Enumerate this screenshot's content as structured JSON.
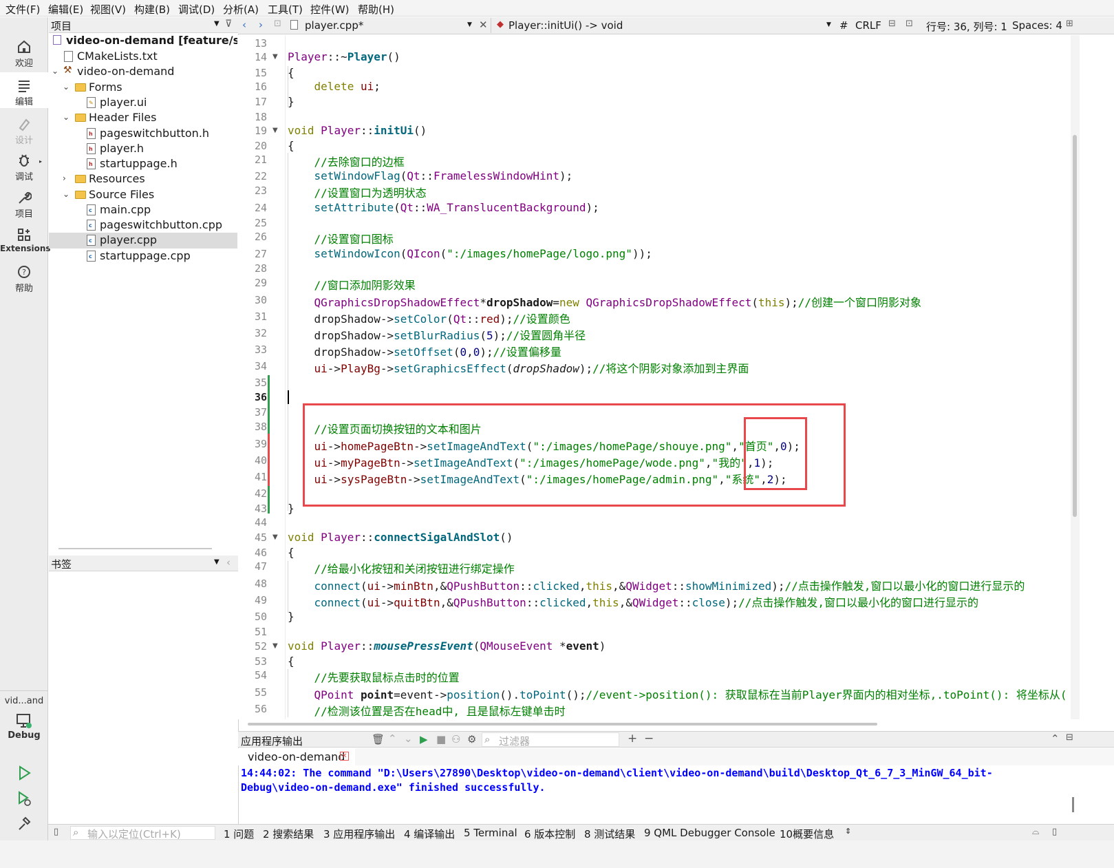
{
  "menu": [
    "文件(F)",
    "编辑(E)",
    "视图(V)",
    "构建(B)",
    "调试(D)",
    "分析(A)",
    "工具(T)",
    "控件(W)",
    "帮助(H)"
  ],
  "modes": {
    "welcome": "欢迎",
    "edit": "编辑",
    "design": "设计",
    "debug": "调试",
    "project": "项目",
    "extensions": "Extensions",
    "help": "帮助",
    "kit_name": "vid...and",
    "kit_mode": "Debug"
  },
  "project_panel": {
    "title": "项目",
    "tree": [
      {
        "label": "video-on-demand [feature/startui"
      },
      {
        "label": "CMakeLists.txt"
      },
      {
        "label": "video-on-demand"
      },
      {
        "label": "Forms"
      },
      {
        "label": "player.ui"
      },
      {
        "label": "Header Files"
      },
      {
        "label": "pageswitchbutton.h"
      },
      {
        "label": "player.h"
      },
      {
        "label": "startuppage.h"
      },
      {
        "label": "Resources"
      },
      {
        "label": "Source Files"
      },
      {
        "label": "main.cpp"
      },
      {
        "label": "pageswitchbutton.cpp"
      },
      {
        "label": "player.cpp"
      },
      {
        "label": "startuppage.cpp"
      }
    ]
  },
  "bookmarks_panel": {
    "title": "书签"
  },
  "editor": {
    "file": "player.cpp*",
    "symbol": "Player::initUi() -> void",
    "hash": "#",
    "line_ending": "CRLF",
    "cursor": "行号: 36, 列号: 1",
    "indent": "Spaces: 4",
    "line_numbers": [
      "13",
      "14",
      "15",
      "16",
      "17",
      "18",
      "19",
      "20",
      "21",
      "22",
      "23",
      "24",
      "25",
      "26",
      "27",
      "28",
      "29",
      "30",
      "31",
      "32",
      "33",
      "34",
      "35",
      "36",
      "37",
      "38",
      "39",
      "40",
      "41",
      "42",
      "43",
      "44",
      "45",
      "46",
      "47",
      "48",
      "49",
      "50",
      "51",
      "52",
      "53",
      "54",
      "55",
      "56"
    ],
    "code_text": {
      "c21": "//去除窗口的边框",
      "c23": "//设置窗口为透明状态",
      "c26": "//设置窗口图标",
      "c29": "//窗口添加阴影效果",
      "c30": "//创建一个窗口阴影对象",
      "c31": "//设置颜色",
      "c32": "//设置圆角半径",
      "c33": "//设置偏移量",
      "c34": "//将这个阴影对象添加到主界面",
      "c38": "//设置页面切换按钮的文本和图片",
      "s39": "\":/images/homePage/shouye.png\"",
      "t39": "\"首页\"",
      "s40": "\":/images/homePage/wode.png\"",
      "t40": "\"我的\"",
      "s41": "\":/images/homePage/admin.png\"",
      "t41": "\"系统\"",
      "c47": "//给最小化按钮和关闭按钮进行绑定操作",
      "c48": "//点击操作触发,窗口以最小化的窗口进行显示的",
      "c49": "//点击操作触发,窗口以最小化的窗口进行显示的",
      "c54": "//先要获取鼠标点击时的位置",
      "c55": "//event->position(): 获取鼠标在当前Player界面内的相对坐标,.toPoint(): 将坐标从(",
      "c56": "//检测该位置是否在head中, 且是鼠标左键单击时",
      "s27": "\":/images/homePage/logo.png\""
    }
  },
  "output": {
    "title": "应用程序输出",
    "filter_placeholder": "过滤器",
    "tab": "video-on-demand",
    "line1": "14:44:02: The command \"D:\\Users\\27890\\Desktop\\video-on-demand\\client\\video-on-demand\\build\\Desktop_Qt_6_7_3_MinGW_64_bit-",
    "line2": "Debug\\video-on-demand.exe\" finished successfully."
  },
  "statusbar": {
    "locator_placeholder": "输入以定位(Ctrl+K)",
    "tabs": [
      "1 问题",
      "2 搜索结果",
      "3 应用程序输出",
      "4 编译输出",
      "5 Terminal",
      "6 版本控制",
      "8 测试结果",
      "9 QML Debugger Console",
      "10概要信息"
    ]
  },
  "colors": {
    "highlight_box": "#e8474c",
    "accent": "#2e8b57",
    "output_text": "#0000ff"
  }
}
